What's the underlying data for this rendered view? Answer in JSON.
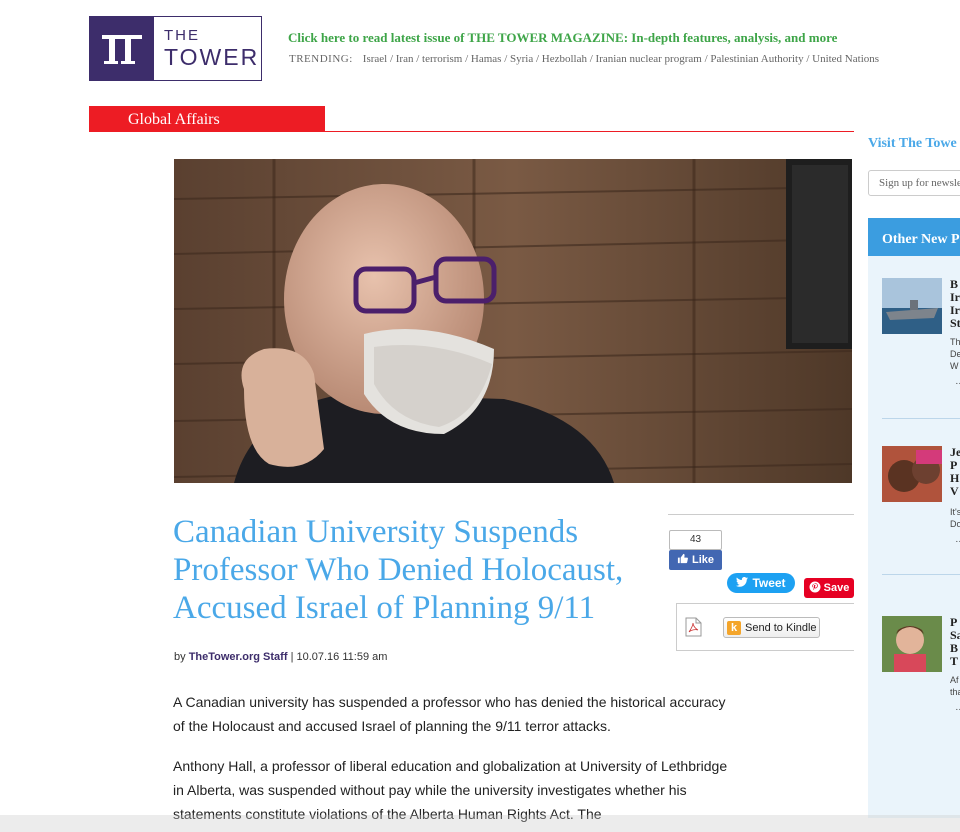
{
  "header": {
    "logo_the": "THE",
    "logo_tower": "TOWER",
    "promo_link": "Click here to read latest issue of THE TOWER MAGAZINE: In-depth features, analysis, and more",
    "trending_label": "TRENDING:",
    "trending_items": "Israel / Iran / terrorism / Hamas / Syria / Hezbollah / Iranian nuclear program / Palestinian Authority / United Nations"
  },
  "section": {
    "label": "Global Affairs"
  },
  "article": {
    "headline": "Canadian University Suspends Professor Who Denied Holocaust, Accused Israel of Planning 9/11",
    "byline_prefix": "by",
    "author": "TheTower.org Staff",
    "date": "| 10.07.16 11:59 am",
    "paragraphs": [
      "A Canadian university has suspended a professor who has denied the historical accuracy of the Holocaust and accused Israel of planning the 9/11 terror attacks.",
      "Anthony Hall, a professor of liberal education and globalization at University of Lethbridge in Alberta, was suspended without pay while the university investigates whether his statements constitute violations of the Alberta Human Rights Act. The"
    ]
  },
  "share": {
    "like_count": "43",
    "like_label": "Like",
    "tweet_label": "Tweet",
    "save_label": "Save",
    "kindle_label": "Send to Kindle"
  },
  "sidebar": {
    "visit_label": "Visit The Towe",
    "newsletter_placeholder": "Sign up for newsle",
    "other_heading": "Other New P",
    "items": [
      {
        "title": "B\nIr\nIr\nSt",
        "desc": "Th\nDe\nW"
      },
      {
        "title": "Je\nP\nH\nV",
        "desc": "It's\nDo"
      },
      {
        "title": "P\nSa\nB\nT",
        "desc": "Af\ntha"
      }
    ]
  },
  "colors": {
    "brand_purple": "#3d2d6b",
    "promo_green": "#3ea548",
    "section_red": "#ed1c24",
    "headline_blue": "#4aa8e8",
    "sidebar_blue": "#3b9de0"
  }
}
